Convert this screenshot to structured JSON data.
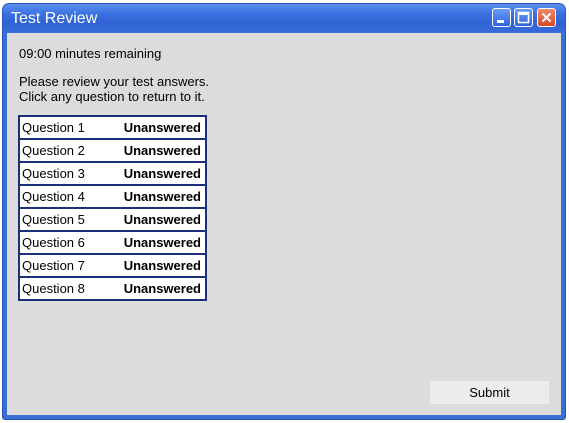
{
  "window": {
    "title": "Test Review"
  },
  "timer": {
    "text": "09:00 minutes remaining"
  },
  "instructions": {
    "line1": "Please review your test answers.",
    "line2": "Click any question to return to it."
  },
  "questions": [
    {
      "label": "Question 1",
      "status": "Unanswered"
    },
    {
      "label": "Question 2",
      "status": "Unanswered"
    },
    {
      "label": "Question 3",
      "status": "Unanswered"
    },
    {
      "label": "Question 4",
      "status": "Unanswered"
    },
    {
      "label": "Question 5",
      "status": "Unanswered"
    },
    {
      "label": "Question 6",
      "status": "Unanswered"
    },
    {
      "label": "Question 7",
      "status": "Unanswered"
    },
    {
      "label": "Question 8",
      "status": "Unanswered"
    }
  ],
  "actions": {
    "submit_label": "Submit"
  },
  "icons": {
    "minimize": "minimize-icon",
    "maximize": "maximize-icon",
    "close": "close-icon"
  },
  "colors": {
    "titlebar": "#3b70e0",
    "table_border": "#1b2f7a",
    "client_bg": "#dcdcdc",
    "close_button": "#d44a25"
  }
}
